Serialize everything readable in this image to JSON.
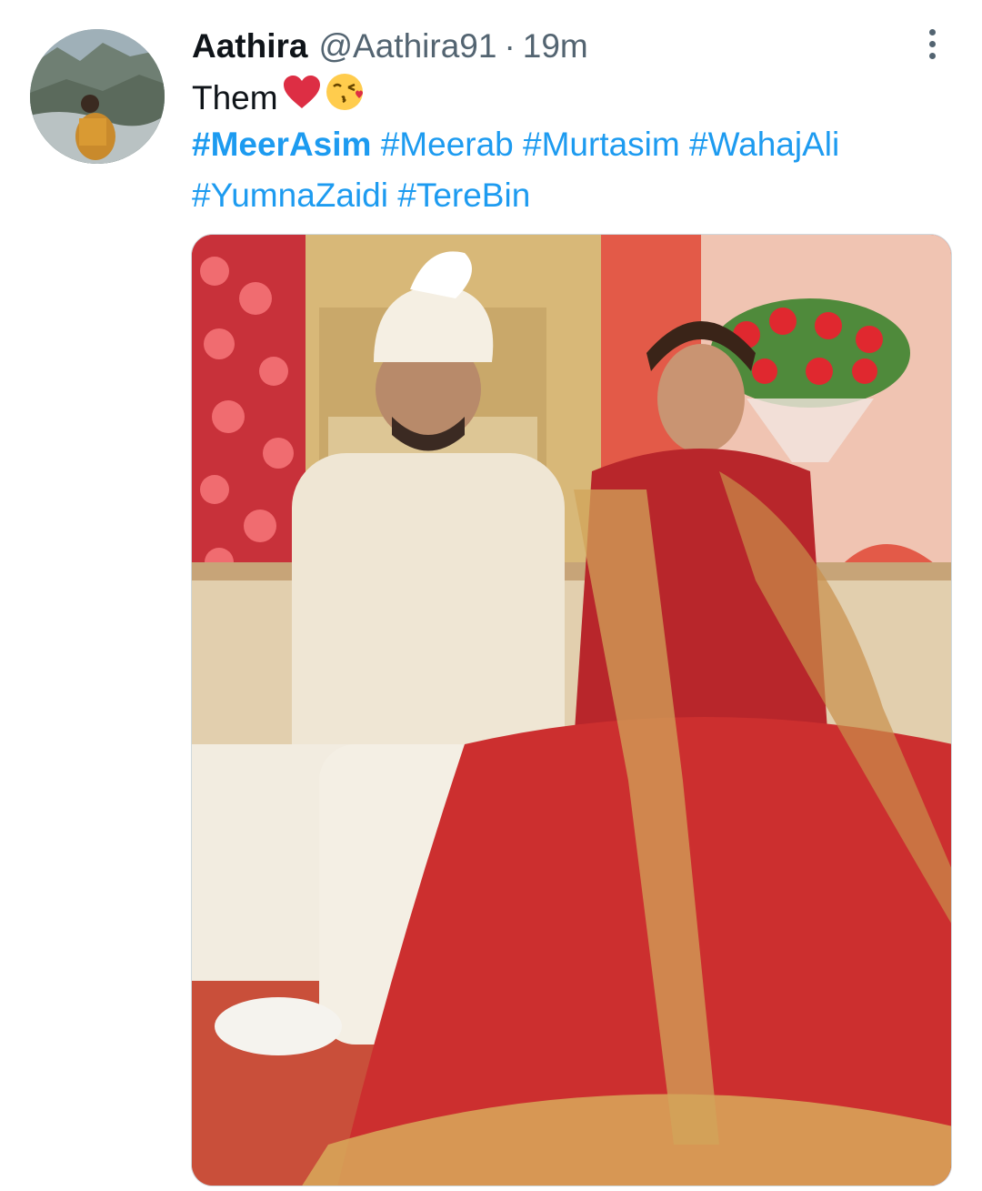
{
  "tweet": {
    "display_name": "Aathira",
    "handle": "@Aathira91",
    "separator": "·",
    "time": "19m",
    "text": "Them",
    "emojis": [
      "red-heart-emoji",
      "face-blowing-kiss-emoji"
    ],
    "hashtags_line1": [
      {
        "text": "#MeerAsim",
        "bold": true
      },
      {
        "text": "#Meerab",
        "bold": false
      },
      {
        "text": "#Murtasim",
        "bold": false
      },
      {
        "text": "#WahajAli",
        "bold": false
      }
    ],
    "hashtags_line2": [
      {
        "text": "#YumnaZaidi",
        "bold": false
      },
      {
        "text": "#TereBin",
        "bold": false
      }
    ]
  },
  "icons": {
    "more": "more-options-icon"
  },
  "colors": {
    "link": "#1d9bf0",
    "text": "#0f1419",
    "secondary": "#536471",
    "border": "#cfd9de"
  }
}
